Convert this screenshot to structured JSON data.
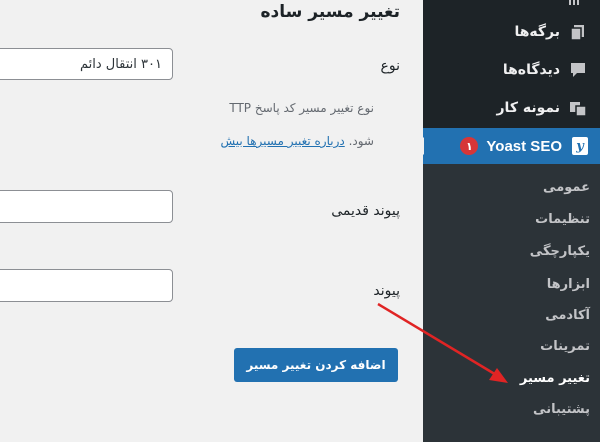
{
  "sidebar": {
    "items": [
      {
        "label": "برگه‌ها",
        "icon": "pages-icon"
      },
      {
        "label": "دیدگاه‌ها",
        "icon": "comments-icon"
      },
      {
        "label": "نمونه کار",
        "icon": "portfolio-icon"
      }
    ],
    "yoast": {
      "label": "Yoast SEO",
      "badge": "۱",
      "logo": "y"
    },
    "submenu": [
      {
        "label": "عمومی"
      },
      {
        "label": "تنظیمات"
      },
      {
        "label": "یکپارچگی"
      },
      {
        "label": "ابزارها"
      },
      {
        "label": "آکادمی"
      },
      {
        "label": "تمرینات"
      },
      {
        "label": "تغییر مسیر",
        "current": true
      },
      {
        "label": "پشتیبانی"
      }
    ]
  },
  "main": {
    "title": "تغییر مسیر ساده",
    "type_label": "نوع",
    "type_value": "۳۰۱ انتقال دائم",
    "help_line1": "نوع تغییر مسیر کد پاسخ TTP",
    "help_line2_prefix": "شود.",
    "help_link": "درباره تغییر مسیرها بیش",
    "old_url_label": "پیوند قدیمی",
    "url_label": "پیوند",
    "add_button": "اضافه کردن تغییر مسیر"
  },
  "colors": {
    "sidebar_bg": "#1d2327",
    "submenu_bg": "#2c3338",
    "accent": "#2271b1",
    "badge": "#d63638",
    "arrow": "#e02424"
  }
}
